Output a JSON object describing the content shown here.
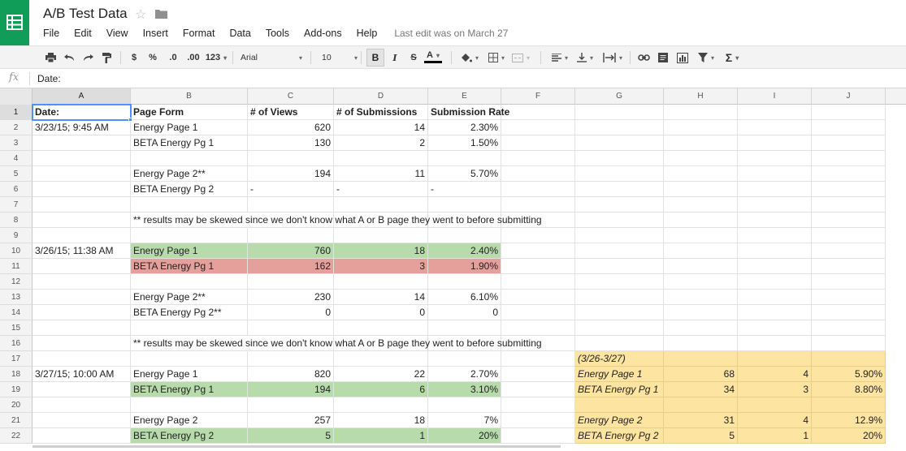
{
  "app": {
    "title": "A/B Test Data",
    "last_edit": "Last edit was on March 27"
  },
  "menu": [
    "File",
    "Edit",
    "View",
    "Insert",
    "Format",
    "Data",
    "Tools",
    "Add-ons",
    "Help"
  ],
  "toolbar": {
    "currency": "$",
    "percent": "%",
    "decrease_decimal": ".0",
    "increase_decimal": ".00",
    "more_formats": "123",
    "font": "Arial",
    "font_size": "10",
    "bold": "B",
    "italic": "I",
    "strike": "S",
    "text_color": "A",
    "functions": "Σ"
  },
  "formula": {
    "fx": "fx",
    "value": "Date:"
  },
  "columns": [
    "A",
    "B",
    "C",
    "D",
    "E",
    "F",
    "G",
    "H",
    "I",
    "J"
  ],
  "rows": [
    {
      "n": "1",
      "cells": {
        "A": {
          "v": "Date:",
          "bold": true
        },
        "B": {
          "v": "Page Form",
          "bold": true
        },
        "C": {
          "v": "# of Views",
          "bold": true
        },
        "D": {
          "v": "# of Submissions",
          "bold": true
        },
        "E": {
          "v": "Submission Rate",
          "bold": true
        }
      }
    },
    {
      "n": "2",
      "cells": {
        "A": {
          "v": "3/23/15; 9:45 AM"
        },
        "B": {
          "v": "Energy Page 1"
        },
        "C": {
          "v": "620",
          "num": true
        },
        "D": {
          "v": "14",
          "num": true
        },
        "E": {
          "v": "2.30%",
          "num": true
        }
      }
    },
    {
      "n": "3",
      "cells": {
        "B": {
          "v": "BETA Energy Pg 1"
        },
        "C": {
          "v": "130",
          "num": true
        },
        "D": {
          "v": "2",
          "num": true
        },
        "E": {
          "v": "1.50%",
          "num": true
        }
      }
    },
    {
      "n": "4",
      "cells": {}
    },
    {
      "n": "5",
      "cells": {
        "B": {
          "v": "Energy Page 2**"
        },
        "C": {
          "v": "194",
          "num": true
        },
        "D": {
          "v": "11",
          "num": true
        },
        "E": {
          "v": "5.70%",
          "num": true
        }
      }
    },
    {
      "n": "6",
      "cells": {
        "B": {
          "v": "BETA Energy Pg 2"
        },
        "C": {
          "v": "-"
        },
        "D": {
          "v": "-"
        },
        "E": {
          "v": "-"
        }
      }
    },
    {
      "n": "7",
      "cells": {}
    },
    {
      "n": "8",
      "cells": {
        "B": {
          "v": "** results may be skewed since we don't know what A or B page they went to before submitting",
          "overflow": true
        }
      }
    },
    {
      "n": "9",
      "cells": {}
    },
    {
      "n": "10",
      "cells": {
        "A": {
          "v": "3/26/15; 11:38 AM"
        },
        "B": {
          "v": "Energy Page 1",
          "fill": "green"
        },
        "C": {
          "v": "760",
          "num": true,
          "fill": "green"
        },
        "D": {
          "v": "18",
          "num": true,
          "fill": "green"
        },
        "E": {
          "v": "2.40%",
          "num": true,
          "fill": "green"
        }
      }
    },
    {
      "n": "11",
      "cells": {
        "B": {
          "v": "BETA Energy Pg 1",
          "fill": "red"
        },
        "C": {
          "v": "162",
          "num": true,
          "fill": "red"
        },
        "D": {
          "v": "3",
          "num": true,
          "fill": "red"
        },
        "E": {
          "v": "1.90%",
          "num": true,
          "fill": "red"
        }
      }
    },
    {
      "n": "12",
      "cells": {}
    },
    {
      "n": "13",
      "cells": {
        "B": {
          "v": "Energy Page 2**"
        },
        "C": {
          "v": "230",
          "num": true
        },
        "D": {
          "v": "14",
          "num": true
        },
        "E": {
          "v": "6.10%",
          "num": true
        }
      }
    },
    {
      "n": "14",
      "cells": {
        "B": {
          "v": "BETA Energy Pg 2**"
        },
        "C": {
          "v": "0",
          "num": true
        },
        "D": {
          "v": "0",
          "num": true
        },
        "E": {
          "v": "0",
          "num": true
        }
      }
    },
    {
      "n": "15",
      "cells": {}
    },
    {
      "n": "16",
      "cells": {
        "B": {
          "v": "** results may be skewed since we don't know what A or B page they went to before submitting",
          "overflow": true
        }
      }
    },
    {
      "n": "17",
      "cells": {
        "G": {
          "v": "(3/26-3/27)",
          "italic": true,
          "fill": "yellow"
        },
        "H": {
          "v": "",
          "fill": "yellow"
        },
        "I": {
          "v": "",
          "fill": "yellow"
        },
        "J": {
          "v": "",
          "fill": "yellow"
        }
      }
    },
    {
      "n": "18",
      "cells": {
        "A": {
          "v": "3/27/15; 10:00 AM"
        },
        "B": {
          "v": "Energy Page 1"
        },
        "C": {
          "v": "820",
          "num": true
        },
        "D": {
          "v": "22",
          "num": true
        },
        "E": {
          "v": "2.70%",
          "num": true
        },
        "G": {
          "v": "Energy Page 1",
          "italic": true,
          "fill": "yellow"
        },
        "H": {
          "v": "68",
          "num": true,
          "fill": "yellow"
        },
        "I": {
          "v": "4",
          "num": true,
          "fill": "yellow"
        },
        "J": {
          "v": "5.90%",
          "num": true,
          "fill": "yellow"
        }
      }
    },
    {
      "n": "19",
      "cells": {
        "B": {
          "v": "BETA Energy Pg 1",
          "fill": "green"
        },
        "C": {
          "v": "194",
          "num": true,
          "fill": "green"
        },
        "D": {
          "v": "6",
          "num": true,
          "fill": "green"
        },
        "E": {
          "v": "3.10%",
          "num": true,
          "fill": "green"
        },
        "G": {
          "v": "BETA Energy Pg 1",
          "italic": true,
          "fill": "yellow"
        },
        "H": {
          "v": "34",
          "num": true,
          "fill": "yellow"
        },
        "I": {
          "v": "3",
          "num": true,
          "fill": "yellow"
        },
        "J": {
          "v": "8.80%",
          "num": true,
          "fill": "yellow"
        }
      }
    },
    {
      "n": "20",
      "cells": {
        "G": {
          "v": "",
          "fill": "yellow"
        },
        "H": {
          "v": "",
          "fill": "yellow"
        },
        "I": {
          "v": "",
          "fill": "yellow"
        },
        "J": {
          "v": "",
          "fill": "yellow"
        }
      }
    },
    {
      "n": "21",
      "cells": {
        "B": {
          "v": "Energy Page 2"
        },
        "C": {
          "v": "257",
          "num": true
        },
        "D": {
          "v": "18",
          "num": true
        },
        "E": {
          "v": "7%",
          "num": true
        },
        "G": {
          "v": "Energy Page 2",
          "italic": true,
          "fill": "yellow"
        },
        "H": {
          "v": "31",
          "num": true,
          "fill": "yellow"
        },
        "I": {
          "v": "4",
          "num": true,
          "fill": "yellow"
        },
        "J": {
          "v": "12.9%",
          "num": true,
          "fill": "yellow"
        }
      }
    },
    {
      "n": "22",
      "cells": {
        "B": {
          "v": "BETA Energy Pg 2",
          "fill": "green"
        },
        "C": {
          "v": "5",
          "num": true,
          "fill": "green"
        },
        "D": {
          "v": "1",
          "num": true,
          "fill": "green"
        },
        "E": {
          "v": "20%",
          "num": true,
          "fill": "green"
        },
        "G": {
          "v": "BETA Energy Pg 2",
          "italic": true,
          "fill": "yellow"
        },
        "H": {
          "v": "5",
          "num": true,
          "fill": "yellow"
        },
        "I": {
          "v": "1",
          "num": true,
          "fill": "yellow"
        },
        "J": {
          "v": "20%",
          "num": true,
          "fill": "yellow"
        }
      }
    }
  ],
  "selection": {
    "cell": "A1",
    "column": "A",
    "row": "1"
  },
  "colors": {
    "brand": "#0f9d58",
    "green_fill": "#b7dbaa",
    "red_fill": "#e6a09b",
    "yellow_fill": "#fde4a0",
    "selection": "#4d90fe"
  }
}
